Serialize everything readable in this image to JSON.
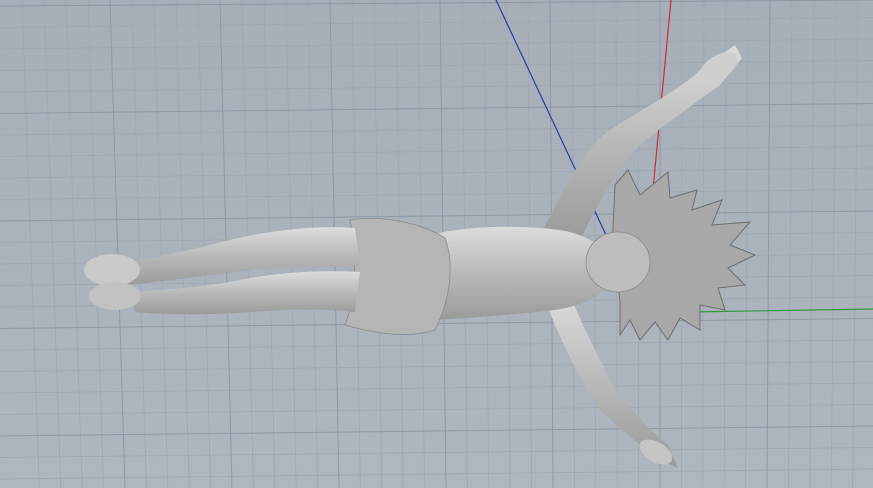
{
  "viewport": {
    "background": "#aab2bc",
    "grid_minor_color": "#9ea6b0",
    "grid_major_color": "#8f98a3",
    "axis_colors": {
      "x": "#2e9a3a",
      "y": "#c8302c",
      "z": "#2c3aa8"
    },
    "model_color": "#c4c4c4",
    "halo_color": "#a9a9a9"
  }
}
